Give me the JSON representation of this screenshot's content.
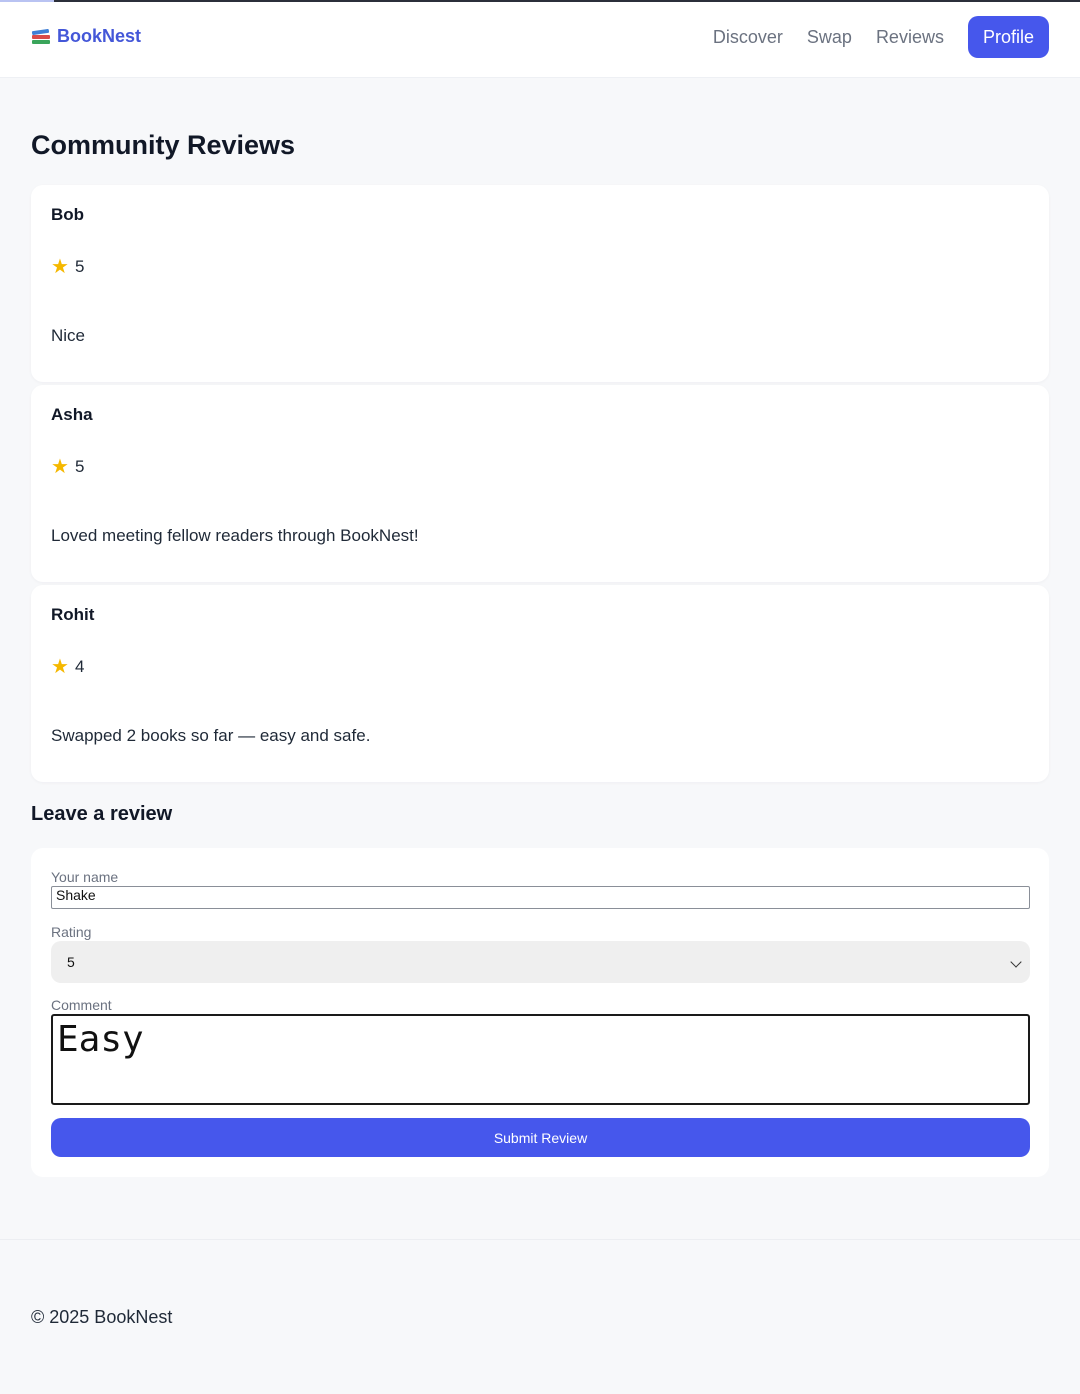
{
  "header": {
    "brand_name": "BookNest",
    "brand_icon": "books-icon",
    "nav": {
      "discover": "Discover",
      "swap": "Swap",
      "reviews": "Reviews",
      "profile": "Profile"
    },
    "accent_color": "#4657ec"
  },
  "main": {
    "title": "Community Reviews",
    "reviews": [
      {
        "name": "Bob",
        "rating": "5",
        "comment": "Nice"
      },
      {
        "name": "Asha",
        "rating": "5",
        "comment": "Loved meeting fellow readers through BookNest!"
      },
      {
        "name": "Rohit",
        "rating": "4",
        "comment": "Swapped 2 books so far — easy and safe."
      }
    ],
    "star_icon": "star-icon"
  },
  "form": {
    "title": "Leave a review",
    "name_label": "Your name",
    "name_value": "Shake",
    "rating_label": "Rating",
    "rating_value": "5",
    "comment_label": "Comment",
    "comment_value": "Easy",
    "submit_label": "Submit Review"
  },
  "footer": {
    "text": "© 2025 BookNest"
  }
}
